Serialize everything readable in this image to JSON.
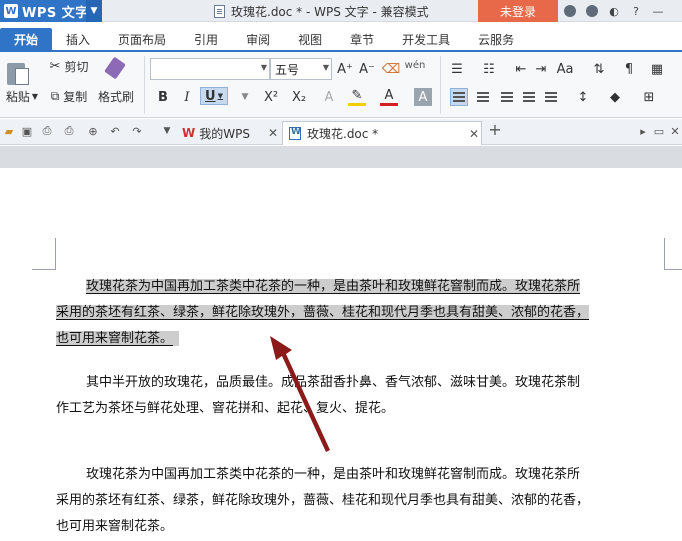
{
  "titlebar": {
    "app_name": "WPS 文字",
    "window_title": "玫瑰花.doc * - WPS 文字 - 兼容模式",
    "login_label": "未登录"
  },
  "tabs": [
    "开始",
    "插入",
    "页面布局",
    "引用",
    "审阅",
    "视图",
    "章节",
    "开发工具",
    "云服务"
  ],
  "ribbon": {
    "paste_label": "粘贴",
    "cut_label": "剪切",
    "copy_label": "复制",
    "format_painter_label": "格式刷",
    "font_name": "",
    "font_size": "五号",
    "bold": "B",
    "italic": "I",
    "underline": "U",
    "superscript": "X²",
    "subscript": "X₂",
    "grow_font": "A⁺",
    "shrink_font": "A⁻",
    "font_color": "A",
    "phonetic": "wén"
  },
  "doc_tabs": {
    "home_tab": "我的WPS",
    "doc_tab": "玫瑰花.doc *",
    "new_tab": "+"
  },
  "document": {
    "paragraphs": [
      {
        "lines": [
          "玫瑰花茶为中国再加工茶类中花茶的一种，是由茶叶和玫瑰鲜花窨制而成。玫瑰花茶所",
          "采用的茶坯有红茶、绿茶，鲜花除玫瑰外，蔷薇、桂花和现代月季也具有甜美、浓郁的花香，",
          "也可用来窨制花茶。"
        ],
        "selected": true
      },
      {
        "lines": [
          "其中半开放的玫瑰花，品质最佳。成品茶甜香扑鼻、香气浓郁、滋味甘美。玫瑰花茶制",
          "作工艺为茶坯与鲜花处理、窨花拼和、起花、复火、提花。"
        ],
        "selected": false
      },
      {
        "lines": [
          "玫瑰花茶为中国再加工茶类中花茶的一种，是由茶叶和玫瑰鲜花窨制而成。玫瑰花茶所",
          "采用的茶坯有红茶、绿茶，鲜花除玫瑰外，蔷薇、桂花和现代月季也具有甜美、浓郁的花香，",
          "也可用来窨制花茶。"
        ],
        "selected": false
      }
    ]
  },
  "colors": {
    "accent": "#2f74c7",
    "login": "#e8694a",
    "selection": "#cdcdcd",
    "arrow": "#8b1a1a"
  }
}
